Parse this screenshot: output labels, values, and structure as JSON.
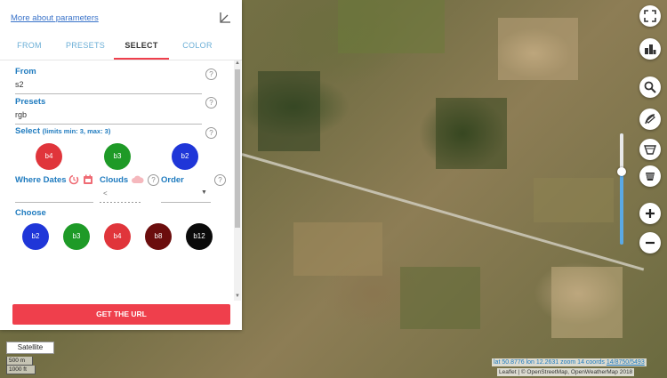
{
  "panel": {
    "more_link": "More about parameters",
    "tabs": [
      "FROM",
      "PRESETS",
      "SELECT",
      "COLOR"
    ],
    "active_tab": "SELECT",
    "from_label": "From",
    "from_value": "s2",
    "presets_label": "Presets",
    "presets_value": "rgb",
    "select_label": "Select",
    "select_limits": "(limits min: 3, max: 3)",
    "selected_bands": [
      {
        "name": "b4",
        "color": "#e0353b"
      },
      {
        "name": "b3",
        "color": "#1e9a27"
      },
      {
        "name": "b2",
        "color": "#1f36d8"
      }
    ],
    "where_dates_label": "Where Dates",
    "clouds_label": "Clouds",
    "clouds_value": "<",
    "order_label": "Order",
    "choose_label": "Choose",
    "choose_bands": [
      {
        "name": "b2",
        "color": "#1f36d8"
      },
      {
        "name": "b3",
        "color": "#1e9a27"
      },
      {
        "name": "b4",
        "color": "#e0353b"
      },
      {
        "name": "b8",
        "color": "#6b0d0d"
      },
      {
        "name": "b12",
        "color": "#0a0a0a"
      }
    ],
    "get_url_label": "GET THE URL"
  },
  "map": {
    "basemap_label": "Satellite",
    "scale_metric": "500 m",
    "scale_imperial": "1000 ft",
    "coords_text": "lat 50.8776 lon 12.2631 zoom 14 coords",
    "coords_link": "14/8750/5493",
    "attribution": "Leaflet | © OpenStreetMap, OpenWeatherMap 2018",
    "opacity_level": 0.66
  },
  "controls": [
    "fullscreen-icon",
    "buildings-icon",
    "search-icon",
    "draw-icon",
    "area-icon",
    "bucket-icon",
    "zoom-in-icon",
    "zoom-out-icon"
  ]
}
